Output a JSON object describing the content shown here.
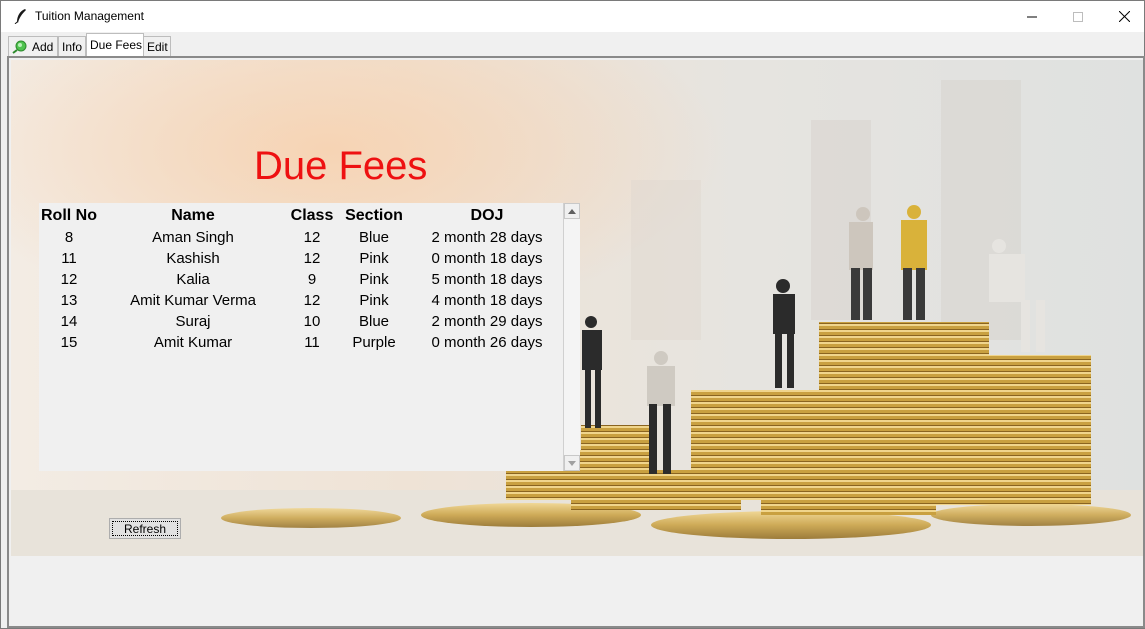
{
  "window": {
    "title": "Tuition Management"
  },
  "tabs": [
    {
      "label": "Add"
    },
    {
      "label": "Info"
    },
    {
      "label": "Due Fees"
    },
    {
      "label": "Edit"
    }
  ],
  "page": {
    "heading": "Due Fees"
  },
  "table": {
    "columns": [
      "Roll No",
      "Name",
      "Class",
      "Section",
      "DOJ"
    ],
    "rows": [
      [
        "8",
        "Aman Singh",
        "12",
        "Blue",
        "2 month 28 days"
      ],
      [
        "11",
        "Kashish",
        "12",
        "Pink",
        "0 month 18 days"
      ],
      [
        "12",
        "Kalia",
        "9",
        "Pink",
        "5 month 18 days"
      ],
      [
        "13",
        "Amit Kumar Verma",
        "12",
        "Pink",
        "4 month 18 days"
      ],
      [
        "14",
        "Suraj",
        "10",
        "Blue",
        "2 month 29 days"
      ],
      [
        "15",
        "Amit Kumar",
        "11",
        "Purple",
        "0 month 26 days"
      ]
    ]
  },
  "buttons": {
    "refresh": "Refresh"
  },
  "colors": {
    "heading": "#ee1111",
    "panel": "#f0f0f0"
  }
}
